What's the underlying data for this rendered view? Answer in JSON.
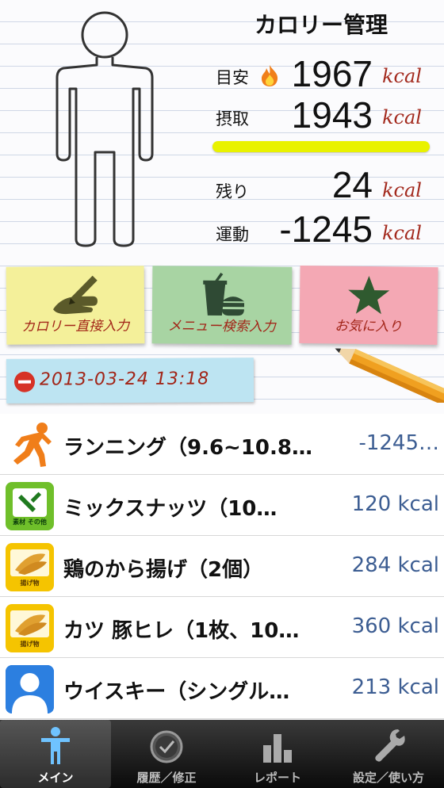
{
  "header": {
    "title": "カロリー管理",
    "target_label": "目安",
    "target_value": "1967",
    "intake_label": "摂取",
    "intake_value": "1943",
    "remaining_label": "残り",
    "remaining_value": "24",
    "exercise_label": "運動",
    "exercise_value": "-1245",
    "unit": "kcal",
    "intake_progress": 0.988
  },
  "buttons": {
    "direct_input": "カロリー直接入力",
    "menu_search": "メニュー検索入力",
    "favorites": "お気に入り"
  },
  "date_tag": "2013-03-24 13:18",
  "entries": [
    {
      "name": "ランニング（9.6~10.8…",
      "kcal": "-1245…",
      "icon": "running-icon"
    },
    {
      "name": "ミックスナッツ（10…",
      "kcal": "120 kcal",
      "icon": "nuts-category-icon",
      "icon_caption": "素材 その他"
    },
    {
      "name": "鶏のから揚げ（2個）",
      "kcal": "284 kcal",
      "icon": "fried-food-icon",
      "icon_caption": "揚げ物"
    },
    {
      "name": "カツ 豚ヒレ（1枚、10…",
      "kcal": "360 kcal",
      "icon": "fried-food-icon",
      "icon_caption": "揚げ物"
    },
    {
      "name": "ウイスキー（シングル…",
      "kcal": "213 kcal",
      "icon": "user-silhouette-icon"
    }
  ],
  "tabs": [
    {
      "label": "メイン",
      "icon": "person-icon",
      "active": true
    },
    {
      "label": "履歴／修正",
      "icon": "clock-icon",
      "active": false
    },
    {
      "label": "レポート",
      "icon": "bar-chart-icon",
      "active": false
    },
    {
      "label": "設定／使い方",
      "icon": "wrench-icon",
      "active": false
    }
  ],
  "colors": {
    "unit": "#a32a1e",
    "kcal_value": "#3c5d92",
    "progress_bar": "#e9f200",
    "note_yellow": "#f4f09a",
    "note_green": "#a8d4a3",
    "note_pink": "#f4a8b4",
    "date_tag": "#bde4f2"
  }
}
